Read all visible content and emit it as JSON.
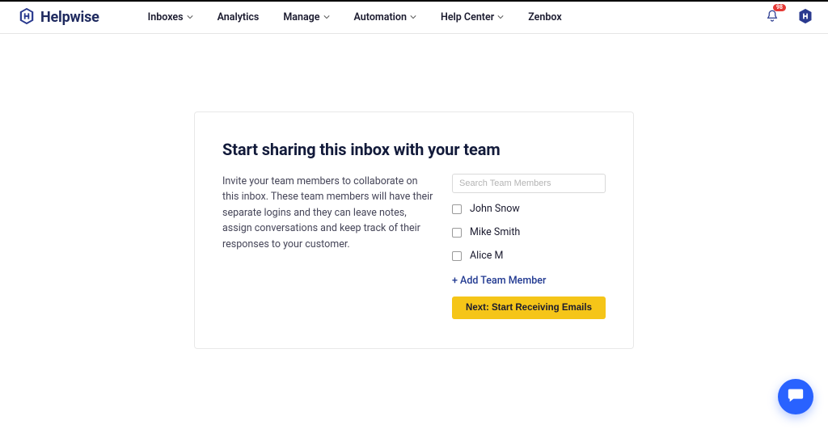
{
  "brand": {
    "name": "Helpwise"
  },
  "nav": {
    "items": [
      {
        "label": "Inboxes",
        "has_chevron": true
      },
      {
        "label": "Analytics",
        "has_chevron": false
      },
      {
        "label": "Manage",
        "has_chevron": true
      },
      {
        "label": "Automation",
        "has_chevron": true
      },
      {
        "label": "Help Center",
        "has_chevron": true
      },
      {
        "label": "Zenbox",
        "has_chevron": false
      }
    ]
  },
  "notifications": {
    "badge": "98"
  },
  "card": {
    "title": "Start sharing this inbox with your team",
    "description": "Invite your team members to collaborate on this inbox. These team members will have their separate logins and they can leave notes, assign conversations and keep track of their responses to your customer.",
    "search_placeholder": "Search Team Members",
    "members": [
      {
        "name": "John Snow"
      },
      {
        "name": "Mike Smith"
      },
      {
        "name": "Alice M"
      }
    ],
    "add_link": "+ Add Team Member",
    "next_button": "Next: Start Receiving Emails"
  }
}
